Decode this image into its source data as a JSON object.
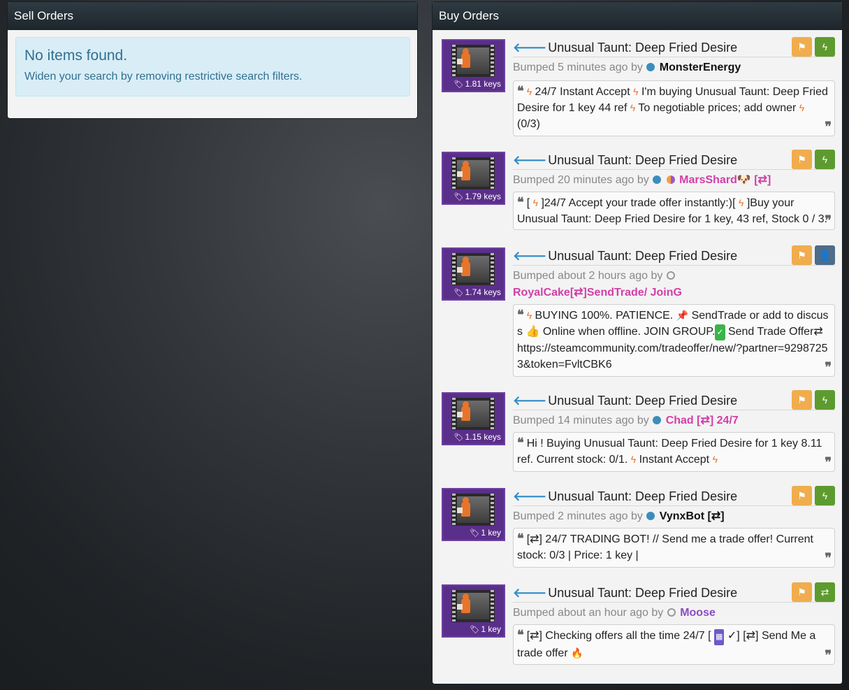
{
  "sell": {
    "title": "Sell Orders",
    "empty_heading": "No items found.",
    "empty_text": "Widen your search by removing restrictive search filters."
  },
  "buy": {
    "title": "Buy Orders",
    "listings": [
      {
        "item": "Unusual Taunt: Deep Fried Desire",
        "price": "1.81 keys",
        "bumped": "Bumped 5 minutes ago by",
        "user": "MonsterEnergy",
        "status": "online",
        "action": "bolt-icon",
        "message": [
          {
            "e": "bolt"
          },
          {
            "t": " 24/7 Instant Accept "
          },
          {
            "e": "bolt"
          },
          {
            "t": " I'm buying Unusual Taunt: Deep Fried Desire for 1 key 44 ref "
          },
          {
            "e": "bolt"
          },
          {
            "t": " To negotiable prices; add owner "
          },
          {
            "e": "bolt"
          },
          {
            "t": " (0/3)"
          }
        ]
      },
      {
        "item": "Unusual Taunt: Deep Fried Desire",
        "price": "1.79 keys",
        "bumped": "Bumped 20 minutes ago by",
        "user": "MarsShard🐶 [⇄]",
        "status": "online",
        "action": "bolt-icon",
        "message": [
          {
            "t": "[ "
          },
          {
            "e": "bolt"
          },
          {
            "t": " ]24/7 Accept your trade offer instantly:)[ "
          },
          {
            "e": "bolt"
          },
          {
            "t": " ]Buy your Unusual Taunt: Deep Fried Desire for 1 key, 43 ref, Stock 0 / 3."
          }
        ]
      },
      {
        "item": "Unusual Taunt: Deep Fried Desire",
        "price": "1.74 keys",
        "bumped": "Bumped about 2 hours ago by",
        "user": "RoyalCake[⇄]SendTrade/ JoinG",
        "status": "offline",
        "action": "add-friend-icon",
        "message": [
          {
            "e": "bolt"
          },
          {
            "t": " BUYING 100%. PATIENCE. "
          },
          {
            "e": "pin"
          },
          {
            "t": " SendTrade or add to discuss 👍 Online when offline. JOIN GROUP."
          },
          {
            "e": "check"
          },
          {
            "t": " Send Trade Offer⇄ https://steamcommunity.com/tradeoffer/new/?partner=92987253&token=FvltCBK6"
          }
        ]
      },
      {
        "item": "Unusual Taunt: Deep Fried Desire",
        "price": "1.15 keys",
        "bumped": "Bumped 14 minutes ago by",
        "user": "Chad [⇄] 24/7",
        "status": "online",
        "action": "bolt-icon",
        "message": [
          {
            "t": "Hi ! Buying Unusual Taunt: Deep Fried Desire for 1 key 8.11 ref. Current stock: 0/1. "
          },
          {
            "e": "bolt"
          },
          {
            "t": " Instant Accept "
          },
          {
            "e": "bolt"
          }
        ]
      },
      {
        "item": "Unusual Taunt: Deep Fried Desire",
        "price": "1 key",
        "bumped": "Bumped 2 minutes ago by",
        "user": "VynxBot [⇄]",
        "status": "online",
        "action": "bolt-icon",
        "message": [
          {
            "t": "[⇄] 24/7 TRADING BOT! // Send me a trade offer! Current stock: 0/3 | Price: 1 key |"
          }
        ]
      },
      {
        "item": "Unusual Taunt: Deep Fried Desire",
        "price": "1 key",
        "bumped": "Bumped about an hour ago by",
        "user": "Moose",
        "status": "offline",
        "action": "trade-icon",
        "message": [
          {
            "t": "[⇄] Checking offers all the time 24/7 [ "
          },
          {
            "e": "cal"
          },
          {
            "t": " ✓] [⇄] Send Me a trade offer "
          },
          {
            "e": "fire"
          }
        ]
      }
    ]
  }
}
